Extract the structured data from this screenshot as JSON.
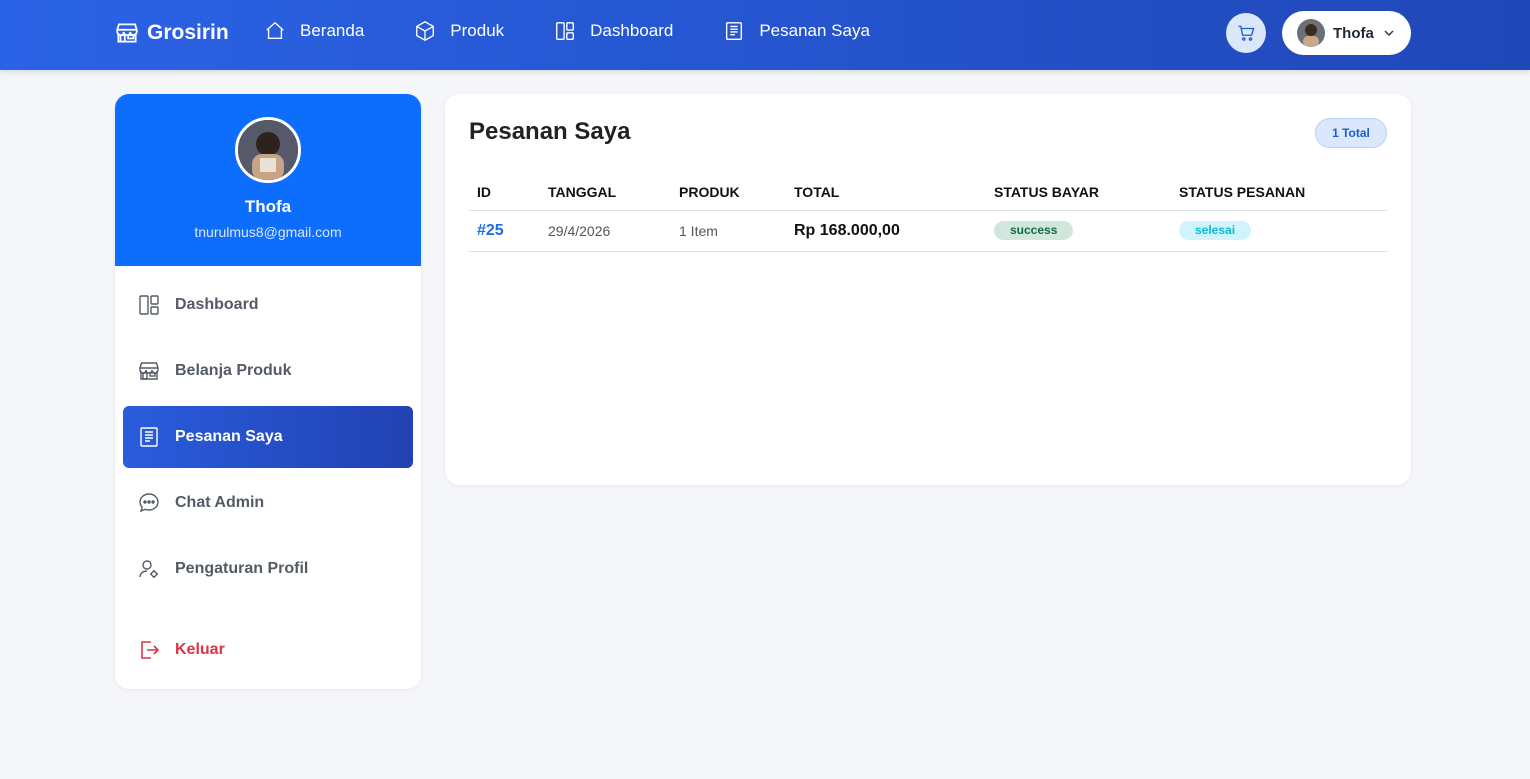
{
  "navbar": {
    "brand": "Grosirin",
    "links": [
      {
        "label": "Beranda",
        "icon": "home-icon"
      },
      {
        "label": "Produk",
        "icon": "box-icon"
      },
      {
        "label": "Dashboard",
        "icon": "dashboard-icon"
      },
      {
        "label": "Pesanan Saya",
        "icon": "receipt-icon"
      }
    ],
    "user_name": "Thofa"
  },
  "sidebar": {
    "name": "Thofa",
    "email": "tnurulmus8@gmail.com",
    "items": [
      {
        "label": "Dashboard",
        "icon": "dashboard-icon"
      },
      {
        "label": "Belanja Produk",
        "icon": "shop-icon"
      },
      {
        "label": "Pesanan Saya",
        "icon": "receipt-icon",
        "active": true
      },
      {
        "label": "Chat Admin",
        "icon": "chat-icon"
      },
      {
        "label": "Pengaturan Profil",
        "icon": "user-gear-icon"
      }
    ],
    "logout": "Keluar"
  },
  "main": {
    "title": "Pesanan Saya",
    "total_badge": "1 Total",
    "columns": [
      "ID",
      "TANGGAL",
      "PRODUK",
      "TOTAL",
      "STATUS BAYAR",
      "STATUS PESANAN"
    ],
    "rows": [
      {
        "id": "#25",
        "date": "29/4/2026",
        "product": "1 Item",
        "total": "Rp 168.000,00",
        "pay_status": "success",
        "order_status": "selesai"
      }
    ]
  },
  "colors": {
    "primary": "#0d6efd",
    "nav_gradient_start": "#2b63e6",
    "nav_gradient_end": "#2047b8",
    "danger": "#dc3545"
  }
}
